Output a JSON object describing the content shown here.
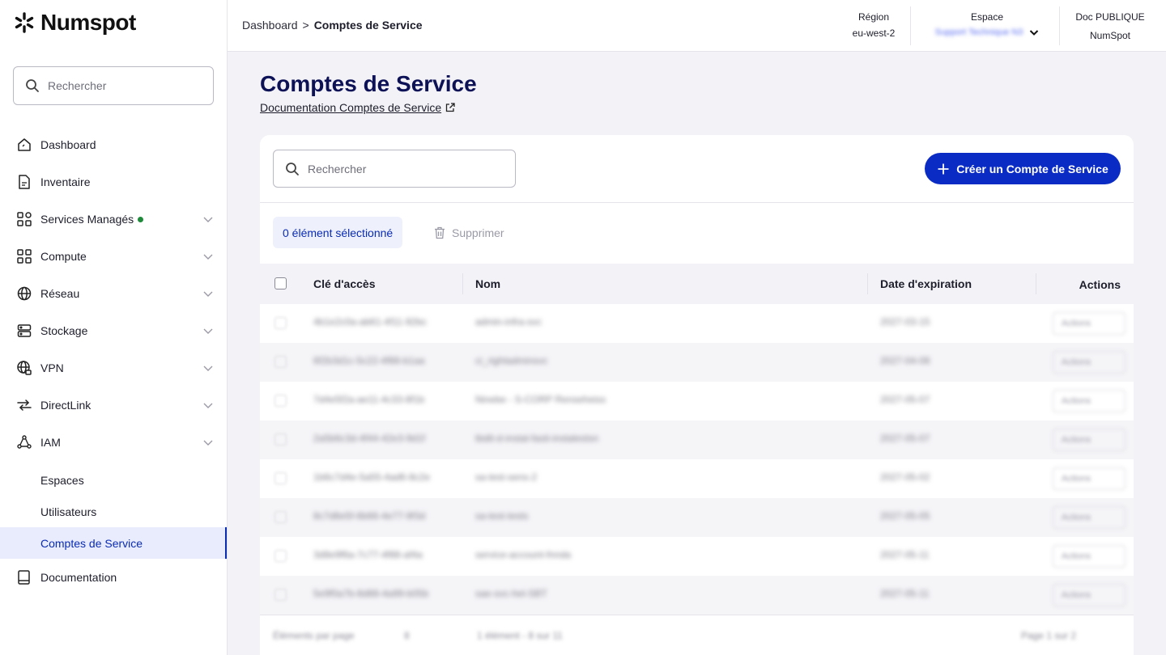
{
  "brand": {
    "name": "Numspot"
  },
  "sidebar": {
    "search_placeholder": "Rechercher",
    "items": [
      {
        "label": "Dashboard",
        "icon": "home-icon"
      },
      {
        "label": "Inventaire",
        "icon": "document-icon"
      },
      {
        "label": "Services Managés",
        "icon": "services-icon",
        "status": "green-dot"
      },
      {
        "label": "Compute",
        "icon": "grid-icon"
      },
      {
        "label": "Réseau",
        "icon": "globe-icon"
      },
      {
        "label": "Stockage",
        "icon": "storage-icon"
      },
      {
        "label": "VPN",
        "icon": "vpn-globe-icon"
      },
      {
        "label": "DirectLink",
        "icon": "directlink-icon"
      },
      {
        "label": "IAM",
        "icon": "iam-icon"
      }
    ],
    "iam_sub": [
      {
        "label": "Espaces"
      },
      {
        "label": "Utilisateurs"
      },
      {
        "label": "Comptes de Service"
      }
    ],
    "documentation": "Documentation"
  },
  "header": {
    "breadcrumb_root": "Dashboard",
    "breadcrumb_sep": ">",
    "breadcrumb_current": "Comptes de Service",
    "region_label": "Région",
    "region_value": "eu-west-2",
    "space_label": "Espace",
    "space_value": "Support Technique N3",
    "account_label": "Doc PUBLIQUE",
    "account_value": "NumSpot"
  },
  "main": {
    "title": "Comptes de Service",
    "doc_link": "Documentation Comptes de Service",
    "search_placeholder": "Rechercher",
    "create_button": "Créer un Compte de Service",
    "selected_label": "0 élément sélectionné",
    "delete_label": "Supprimer"
  },
  "table": {
    "columns": [
      "Clé d'accès",
      "Nom",
      "Date d'expiration",
      "Actions"
    ],
    "rows": [
      {
        "key": "4b1e2c0a-ab61-4f11-92bc",
        "name": "admin-infra-svc",
        "date": "2027-03-15",
        "action": "Actions"
      },
      {
        "key": "6f2b3d1c-5c22-4f88-b1aa",
        "name": "ci_rightadminsvc",
        "date": "2027-04-08",
        "action": "Actions"
      },
      {
        "key": "7d4e5f2a-ae11-4c33-8f1b",
        "name": "Ninebe - S-CORP Renseheiss",
        "date": "2027-05-07",
        "action": "Actions"
      },
      {
        "key": "2a5b6c3d-4f44-42e3-9d1f",
        "name": "tbdit-d-instal-fasti-instalestsn",
        "date": "2027-05-07",
        "action": "Actions"
      },
      {
        "key": "1b6c7d4e-5a55-4ad6-8c2e",
        "name": "sa-test-sens-2",
        "date": "2027-05-02",
        "action": "Actions"
      },
      {
        "key": "8c7d8e5f-6b66-4e77-9f3d",
        "name": "sa-test-tests",
        "date": "2027-05-05",
        "action": "Actions"
      },
      {
        "key": "3d8e9f6a-7c77-4f88-af4a",
        "name": "service-account-fnnda",
        "date": "2027-05-11",
        "action": "Actions"
      },
      {
        "key": "5e9f0a7b-8d88-4a99-b05b",
        "name": "sae-svc-hel-SBT",
        "date": "2027-05-11",
        "action": "Actions"
      }
    ]
  },
  "pagination": {
    "per_page_label": "Éléments par page",
    "per_page_value": "8",
    "range_label": "1 élément - 8 sur 11",
    "page_label": "Page 1 sur 2"
  },
  "colors": {
    "brand_blue": "#0a2bc4",
    "title_navy": "#0d1257",
    "status_green": "#1e8a3a"
  }
}
